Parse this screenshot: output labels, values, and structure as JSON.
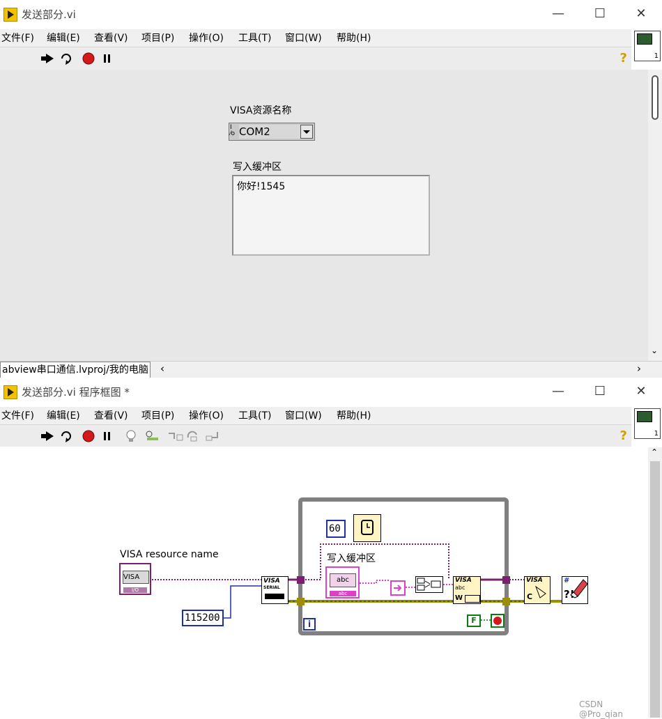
{
  "front_panel": {
    "window_title": "发送部分.vi",
    "menu": [
      "文件(F)",
      "编辑(E)",
      "查看(V)",
      "项目(P)",
      "操作(O)",
      "工具(T)",
      "窗口(W)",
      "帮助(H)"
    ],
    "visa_label": "VISA资源名称",
    "visa_value": "COM2",
    "visa_prefix": "I/O",
    "write_buffer_label": "写入缓冲区",
    "write_buffer_value": "你好!1545",
    "status_path": "abview串口通信.lvproj/我的电脑"
  },
  "block_diagram": {
    "window_title": "发送部分.vi 程序框图 *",
    "menu": [
      "文件(F)",
      "编辑(E)",
      "查看(V)",
      "项目(P)",
      "操作(O)",
      "工具(T)",
      "窗口(W)",
      "帮助(H)"
    ],
    "visa_resource_label": "VISA resource name",
    "visa_terminal_text": "VISA",
    "visa_terminal_io": "I/O",
    "baud_constant": "115200",
    "wait_constant": "60",
    "loop_iteration": "i",
    "write_buffer_label": "写入缓冲区",
    "string_terminal_text": "abc",
    "false_constant": "F",
    "serial_node_text": "VISA",
    "serial_node_sub": "SERIAL",
    "write_node_text": "VISA",
    "write_node_sub": "abc",
    "write_node_w": "W",
    "close_node_text": "VISA",
    "close_node_sub": "C",
    "error_node_text": "?!"
  },
  "watermark": "CSDN @Pro_qian",
  "colors": {
    "string_wire": "#e040c8",
    "visa_wire": "#7b1f6e",
    "error_wire": "#9a8f00",
    "numeric_wire": "#1f2fa8",
    "boolean": "#0b7a13",
    "loop_border": "#808080"
  }
}
